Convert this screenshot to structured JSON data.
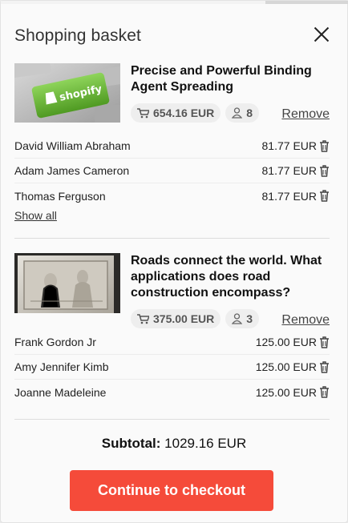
{
  "header": {
    "title": "Shopping basket"
  },
  "products": [
    {
      "name": "Precise and Powerful Binding Agent Spreading",
      "image_text": "shopify",
      "price": "654.16 EUR",
      "participants": "8",
      "remove_label": "Remove",
      "rows": [
        {
          "name": "David William Abraham",
          "amount": "81.77 EUR"
        },
        {
          "name": "Adam James Cameron",
          "amount": "81.77 EUR"
        },
        {
          "name": "Thomas Ferguson",
          "amount": "81.77 EUR"
        }
      ],
      "show_all_label": "Show all"
    },
    {
      "name": "Roads connect the world. What applications does road construction encompass?",
      "price": "375.00 EUR",
      "participants": "3",
      "remove_label": "Remove",
      "rows": [
        {
          "name": "Frank Gordon Jr",
          "amount": "125.00 EUR"
        },
        {
          "name": "Amy Jennifer Kimb",
          "amount": "125.00 EUR"
        },
        {
          "name": "Joanne Madeleine",
          "amount": "125.00 EUR"
        }
      ]
    }
  ],
  "summary": {
    "subtotal_label": "Subtotal:",
    "subtotal_value": "1029.16 EUR"
  },
  "checkout": {
    "label": "Continue to checkout"
  },
  "colors": {
    "accent": "#f54b3a",
    "shopify_green": "#6dbf3a"
  }
}
